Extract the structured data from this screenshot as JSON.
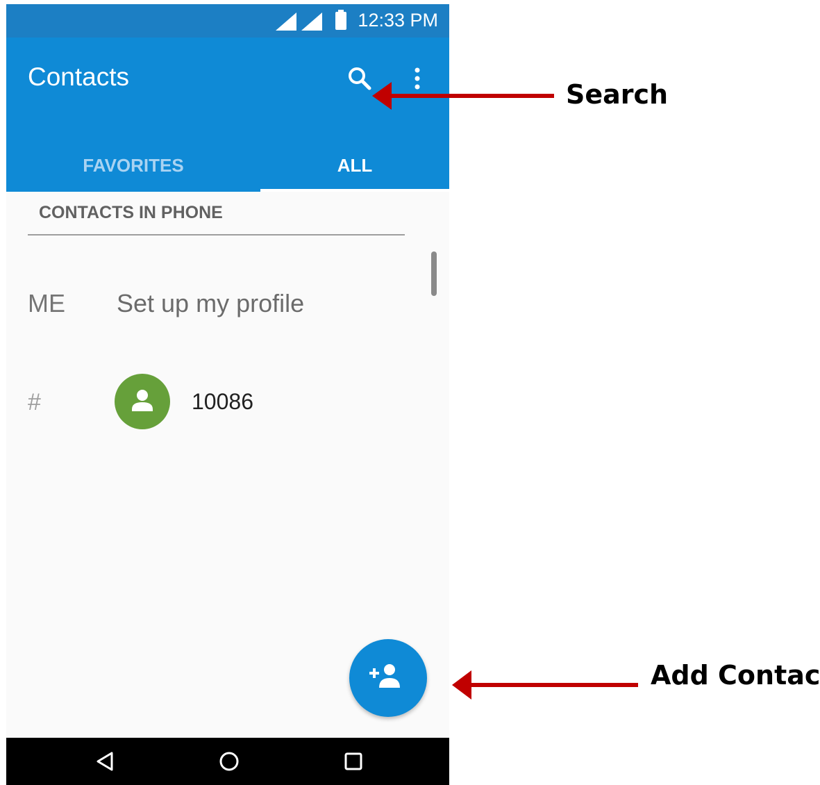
{
  "status_bar": {
    "time": "12:33 PM"
  },
  "app_bar": {
    "title": "Contacts",
    "search_icon": "search-icon",
    "overflow_icon": "more-vert-icon",
    "tabs": [
      {
        "label": "FAVORITES",
        "selected": false
      },
      {
        "label": "ALL",
        "selected": true
      }
    ]
  },
  "contacts_list": {
    "section_header": "CONTACTS IN PHONE",
    "profile_row": {
      "index_label": "ME",
      "text": "Set up my profile"
    },
    "groups": [
      {
        "index_label": "#",
        "items": [
          {
            "name": "10086",
            "avatar_icon": "person-icon",
            "avatar_color": "#66a03a"
          }
        ]
      }
    ]
  },
  "fab": {
    "icon": "add-contact-icon"
  },
  "nav_bar": {
    "icons": [
      "back-icon",
      "home-icon",
      "recents-icon"
    ]
  },
  "annotations": [
    {
      "label": "Search"
    },
    {
      "label": "Add Contact"
    }
  ],
  "colors": {
    "primary": "#0f8ad6",
    "status_bar": "#1c7fc4",
    "annotation_arrow": "#c00000"
  }
}
